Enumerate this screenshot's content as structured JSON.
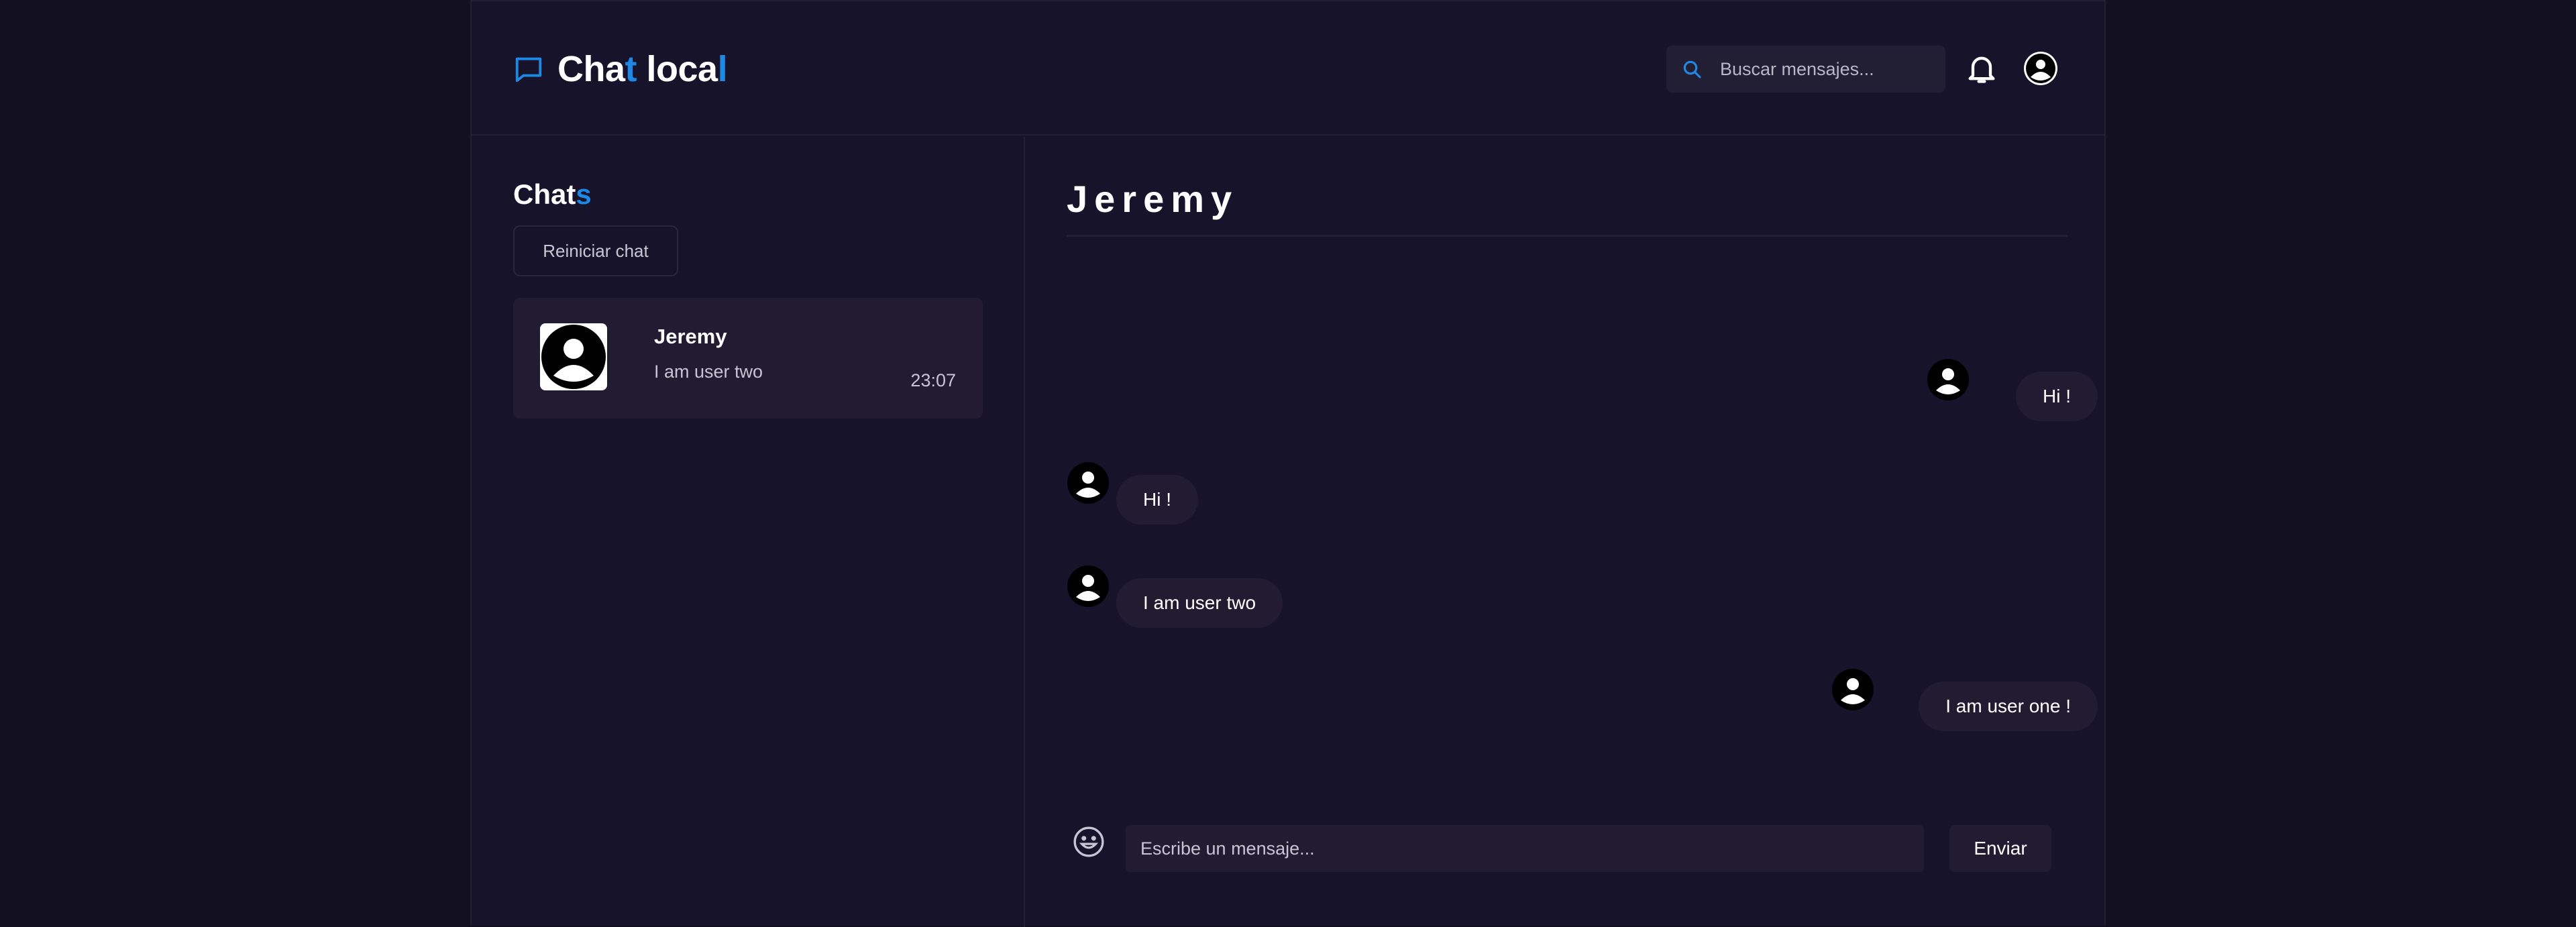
{
  "app": {
    "title_parts": [
      "Cha",
      "t",
      " loca",
      "l"
    ],
    "accent_color": "#1e88e5"
  },
  "header": {
    "search_placeholder": "Buscar mensajes...",
    "icons": [
      "chat-bubble-icon",
      "search-icon",
      "bell-icon",
      "user-avatar-icon"
    ]
  },
  "sidebar": {
    "title_parts": [
      "Chat",
      "s"
    ],
    "reset_label": "Reiniciar chat",
    "chats": [
      {
        "name": "Jeremy",
        "preview": "I am user two",
        "time": "23:07"
      }
    ]
  },
  "chat": {
    "title": "Jeremy",
    "messages": [
      {
        "text": "Hi !",
        "side": "right"
      },
      {
        "text": "Hi !",
        "side": "left"
      },
      {
        "text": "I am user two",
        "side": "left"
      },
      {
        "text": "I am user one !",
        "side": "right"
      }
    ],
    "input_placeholder": "Escribe un mensaje...",
    "send_label": "Enviar"
  }
}
